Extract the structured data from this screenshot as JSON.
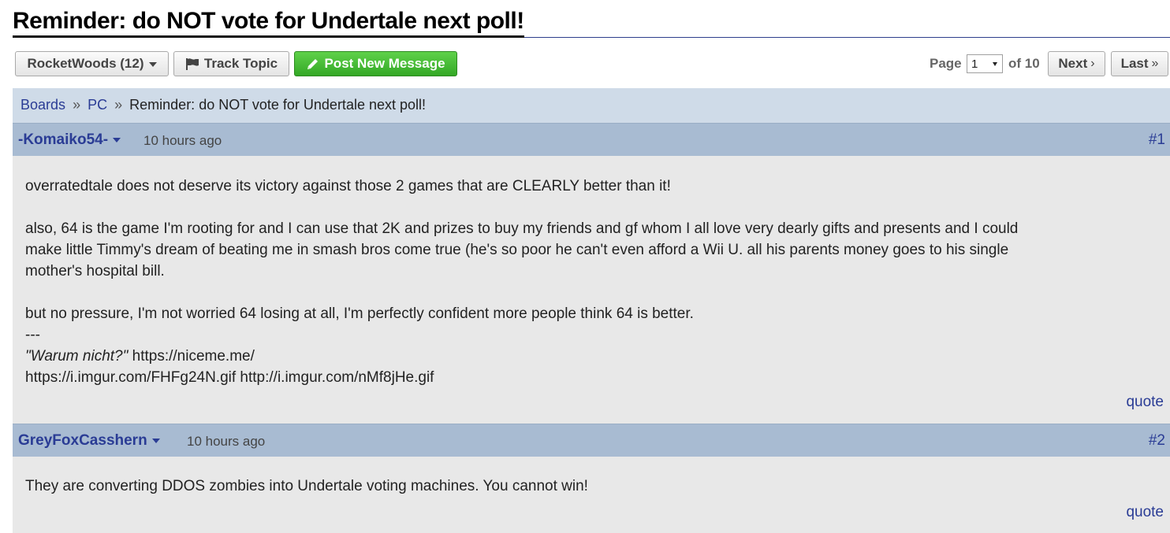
{
  "topic": {
    "title": "Reminder: do NOT vote for Undertale next poll!"
  },
  "toolbar": {
    "user_label": "RocketWoods (12)",
    "track_label": "Track Topic",
    "post_label": "Post New Message",
    "post_color": "#3fb82f"
  },
  "pager": {
    "page_label": "Page",
    "current_page": "1",
    "of_label": "of 10",
    "next_label": "Next",
    "last_label": "Last"
  },
  "breadcrumb": {
    "boards": "Boards",
    "sep": "»",
    "board": "PC",
    "current": "Reminder: do NOT vote for Undertale next poll!"
  },
  "messages": [
    {
      "author": "-Komaiko54-",
      "time": "10 hours ago",
      "number": "#1",
      "line1": "overratedtale does not deserve its victory against those 2 games that are CLEARLY better than it!",
      "line2": "also, 64 is the game I'm rooting for and I can use that 2K and prizes to buy my friends and gf whom I all love very dearly gifts and presents and I could",
      "line3": "make little Timmy's dream of beating me in smash bros come true (he's so poor he can't even afford a Wii U. all his parents money goes to his single",
      "line4": "mother's hospital bill.",
      "line5": "but no pressure, I'm not worried 64 losing at all, I'm perfectly confident more people think 64 is better.",
      "sig_sep": "---",
      "sig_quote": "\"Warum nicht?\"",
      "sig_link1": "https://niceme.me/",
      "sig_line2": "https://i.imgur.com/FHFg24N.gif http://i.imgur.com/nMf8jHe.gif",
      "quote_label": "quote"
    },
    {
      "author": "GreyFoxCasshern",
      "time": "10 hours ago",
      "number": "#2",
      "line1": "They are converting DDOS zombies into Undertale voting machines. You cannot win!",
      "quote_label": "quote"
    }
  ],
  "colors": {
    "link": "#2a3c95",
    "header_bg": "#a8bbd2",
    "breadcrumb_bg": "#cfdbe8",
    "body_bg": "#e8e8e8"
  }
}
